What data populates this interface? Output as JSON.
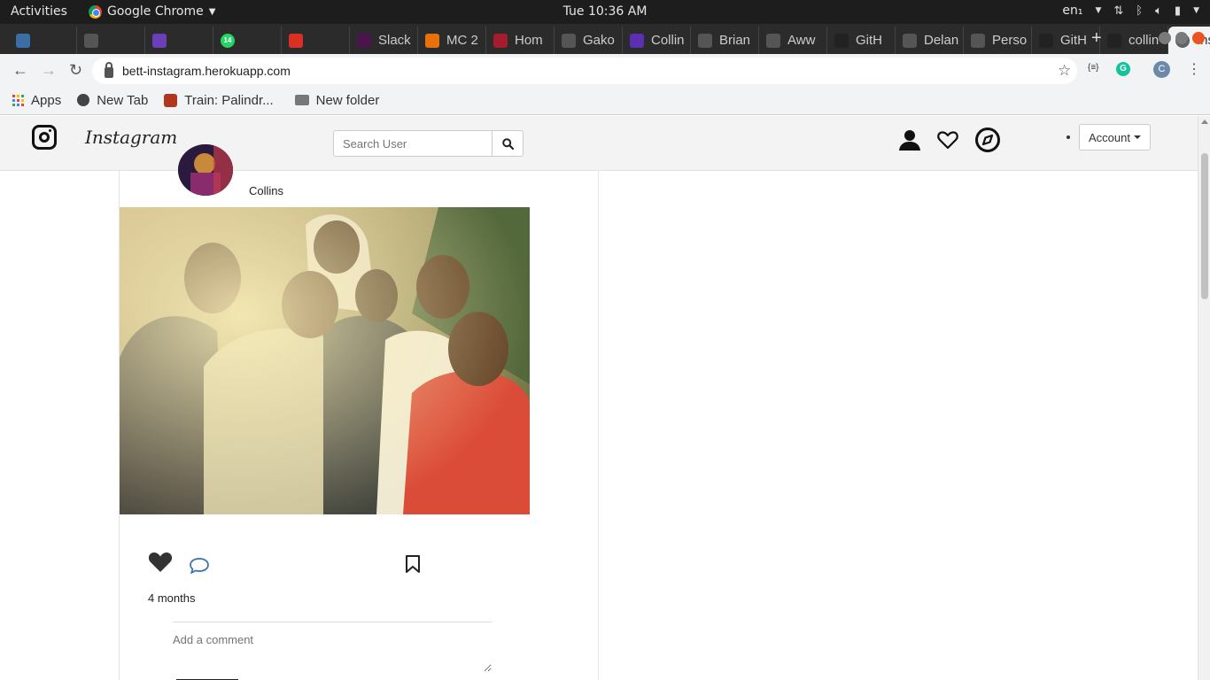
{
  "os": {
    "activities": "Activities",
    "app_name": "Google Chrome",
    "clock": "Tue 10:36 AM",
    "lang": "en₁"
  },
  "tabs": [
    {
      "label": "",
      "icon": "chart-icon",
      "color": "#3b6ea5"
    },
    {
      "label": "",
      "icon": "blank-icon",
      "color": "#555555"
    },
    {
      "label": "",
      "icon": "graduation-icon",
      "color": "#6a3fb8"
    },
    {
      "label": "",
      "icon": "whatsapp-icon",
      "color": "#25d366",
      "badge": "14"
    },
    {
      "label": "",
      "icon": "gmail-icon",
      "color": "#d93025"
    },
    {
      "label": "Slack",
      "icon": "slack-icon",
      "color": "#4a154b"
    },
    {
      "label": "MC 2",
      "icon": "mc-icon",
      "color": "#e8710a"
    },
    {
      "label": "Hom",
      "icon": "arrow-icon",
      "color": "#a51d2d"
    },
    {
      "label": "Gako",
      "icon": "blank-icon",
      "color": "#555555"
    },
    {
      "label": "Collin",
      "icon": "c-icon",
      "color": "#5b2fb0"
    },
    {
      "label": "Brian",
      "icon": "blank-icon",
      "color": "#555555"
    },
    {
      "label": "Aww",
      "icon": "blank-icon",
      "color": "#555555"
    },
    {
      "label": "GitH",
      "icon": "angular-icon",
      "color": "#222222"
    },
    {
      "label": "Delan",
      "icon": "blank-icon",
      "color": "#555555"
    },
    {
      "label": "Perso",
      "icon": "blank-icon",
      "color": "#555555"
    },
    {
      "label": "GitH",
      "icon": "github-icon",
      "color": "#222222"
    },
    {
      "label": "collin",
      "icon": "github-icon",
      "color": "#222222"
    }
  ],
  "active_tab": {
    "label": "Ins",
    "icon": "globe-icon"
  },
  "address": {
    "url": "bett-instagram.herokuapp.com"
  },
  "profile_initial": "C",
  "bookmarks": [
    {
      "label": "Apps",
      "icon": "apps-grid-icon"
    },
    {
      "label": "New Tab",
      "icon": "newtab-icon"
    },
    {
      "label": "Train: Palindr...",
      "icon": "codewars-icon"
    },
    {
      "label": "New folder",
      "icon": "folder-icon"
    }
  ],
  "site": {
    "wordmark": "Instagram",
    "search_placeholder": "Search User",
    "account_label": "Account"
  },
  "post": {
    "username": "Collins",
    "time": "4 months",
    "comment_placeholder": "Add a comment"
  }
}
